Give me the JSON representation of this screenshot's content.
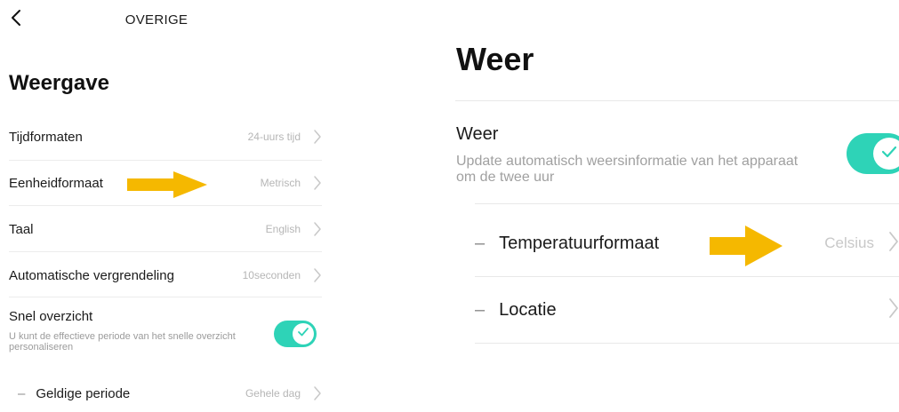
{
  "left_panel": {
    "header": {
      "title": "OVERIGE"
    },
    "section_title": "Weergave",
    "rows": [
      {
        "label": "Tijdformaten",
        "value": "24-uurs tijd"
      },
      {
        "label": "Eenheidformaat",
        "value": "Metrisch"
      },
      {
        "label": "Taal",
        "value": "English"
      },
      {
        "label": "Automatische vergrendeling",
        "value": "10seconden"
      }
    ],
    "quick_view": {
      "label": "Snel overzicht",
      "description": "U kunt de effectieve periode van het snelle overzicht personaliseren",
      "enabled": true
    },
    "sub_row": {
      "dash": "–",
      "label": "Geldige periode",
      "value": "Gehele dag"
    }
  },
  "right_panel": {
    "section_title": "Weer",
    "weather": {
      "label": "Weer",
      "description": "Update automatisch weersinformatie van het apparaat om de twee uur",
      "enabled": true
    },
    "sub_rows": [
      {
        "dash": "–",
        "label": "Temperatuurformaat",
        "value": "Celsius"
      },
      {
        "dash": "–",
        "label": "Locatie",
        "value": ""
      }
    ]
  },
  "colors": {
    "toggle_on": "#2ed3b7",
    "highlight_arrow": "#f5b800",
    "secondary_text": "#b6b6b6"
  },
  "icons": {
    "back": "chevron-left-icon",
    "chevron": "chevron-right-icon",
    "check": "check-icon",
    "annotation": "arrow-right-icon"
  }
}
